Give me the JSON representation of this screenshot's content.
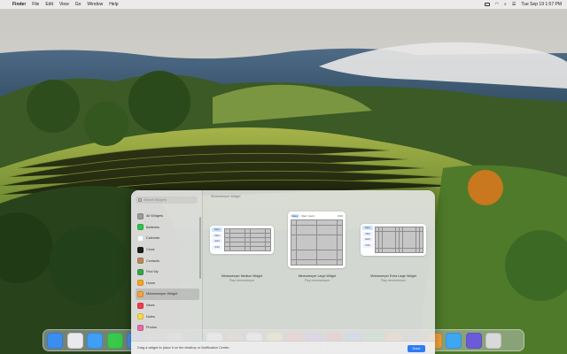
{
  "menubar": {
    "app_name": "Finder",
    "items": [
      "File",
      "Edit",
      "View",
      "Go",
      "Window",
      "Help"
    ],
    "clock": "Tue Sep 19  1:57 PM"
  },
  "gallery": {
    "search_placeholder": "Search Widgets",
    "categories": [
      {
        "label": "All Widgets",
        "icon": "grid-icon",
        "color": "#9b9b9b"
      },
      {
        "label": "Batteries",
        "icon": "battery-icon",
        "color": "#33c24d"
      },
      {
        "label": "Calendar",
        "icon": "calendar-icon",
        "color": "#ffffff"
      },
      {
        "label": "Clock",
        "icon": "clock-icon",
        "color": "#1c1c1c"
      },
      {
        "label": "Contacts",
        "icon": "contacts-icon",
        "color": "#b98b5a"
      },
      {
        "label": "Find My",
        "icon": "findmy-icon",
        "color": "#3aa24a"
      },
      {
        "label": "Home",
        "icon": "home-icon",
        "color": "#f6a623"
      },
      {
        "label": "Minesweeper Widget",
        "icon": "minesweeper-icon",
        "color": "#f2a33a",
        "selected": true
      },
      {
        "label": "News",
        "icon": "news-icon",
        "color": "#f23b4c"
      },
      {
        "label": "Notes",
        "icon": "notes-icon",
        "color": "#f7d64a"
      },
      {
        "label": "Photos",
        "icon": "photos-icon",
        "color": "#e86ca0"
      }
    ],
    "content_title": "Minesweeper Widget",
    "widgets": [
      {
        "title": "Minesweeper Medium Widget",
        "subtitle": "Play minesweeper",
        "size": "medium"
      },
      {
        "title": "Minesweeper Large Widget",
        "subtitle": "Play minesweeper",
        "size": "large"
      },
      {
        "title": "Minesweeper Extra Large Widget",
        "subtitle": "Play minesweeper",
        "size": "extra-large"
      }
    ],
    "widget_controls": {
      "easy": "Easy",
      "medium": "Med",
      "hard": "Hard",
      "count": "0/10"
    },
    "hint": "Drag a widget to place it on the desktop or Notification Center.",
    "done_label": "Done"
  },
  "dock": {
    "apps": [
      {
        "name": "finder-icon",
        "color": "#3b8df0"
      },
      {
        "name": "launchpad-icon",
        "color": "#e9e9ee"
      },
      {
        "name": "safari-icon",
        "color": "#3f9ef5"
      },
      {
        "name": "messages-icon",
        "color": "#38c94b"
      },
      {
        "name": "mail-icon",
        "color": "#4a90e8"
      },
      {
        "name": "maps-icon",
        "color": "#6fc36b"
      },
      {
        "name": "photos-icon",
        "color": "#f4f4f4"
      },
      {
        "name": "facetime-icon",
        "color": "#3cc05a"
      },
      {
        "name": "calendar-icon",
        "color": "#ffffff"
      },
      {
        "name": "contacts-icon",
        "color": "#b98b5a"
      },
      {
        "name": "reminders-icon",
        "color": "#f8f8f8"
      },
      {
        "name": "notes-icon",
        "color": "#f7d64a"
      },
      {
        "name": "music-icon",
        "color": "#fa4b5f"
      },
      {
        "name": "podcasts-icon",
        "color": "#9f56e2"
      },
      {
        "name": "news-icon",
        "color": "#f23b4c"
      },
      {
        "name": "keynote-icon",
        "color": "#2f86f0"
      },
      {
        "name": "numbers-icon",
        "color": "#35b35a"
      },
      {
        "name": "pages-icon",
        "color": "#f39b2b"
      },
      {
        "name": "system-settings-icon",
        "color": "#8e8e93"
      },
      {
        "name": "minesweeper-icon",
        "color": "#f2a33a"
      },
      {
        "name": "downloads-folder-icon",
        "color": "#3fa7f2"
      },
      {
        "name": "screenshots-icon",
        "color": "#6b5bd9"
      },
      {
        "name": "trash-icon",
        "color": "#d9d9d9"
      }
    ]
  }
}
